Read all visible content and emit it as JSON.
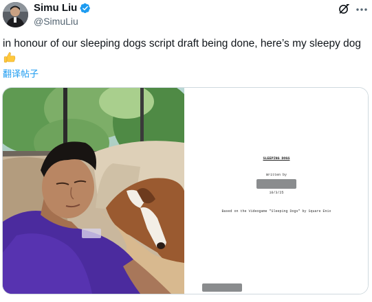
{
  "author": {
    "name": "Simu Liu",
    "handle": "@SimuLiu",
    "verified": true,
    "verified_color": "#1d9bf0",
    "avatar_icon": "profile-photo"
  },
  "header_icons": [
    "grok-icon",
    "more-options-icon"
  ],
  "tweet": {
    "text": "in honour of our sleeping dogs script draft being done, here’s my sleepy dog",
    "emoji": "thumbs-up-emoji"
  },
  "translate_label": "翻译帖子",
  "media": {
    "photo": "man-and-dog-lying-on-couch",
    "script_page": {
      "title": "SLEEPING DOGS",
      "written_by": "Written by",
      "author_redacted": true,
      "date": "10/3/25",
      "based_on": "Based on the Videogame \"Sleeping Dogs\" by Square Enix",
      "footer_redacted": true
    }
  },
  "colors": {
    "text": "#0f1419",
    "secondary": "#536471",
    "link": "#1d9bf0",
    "border": "#cfd9de",
    "redaction": "#8a8c8e"
  }
}
